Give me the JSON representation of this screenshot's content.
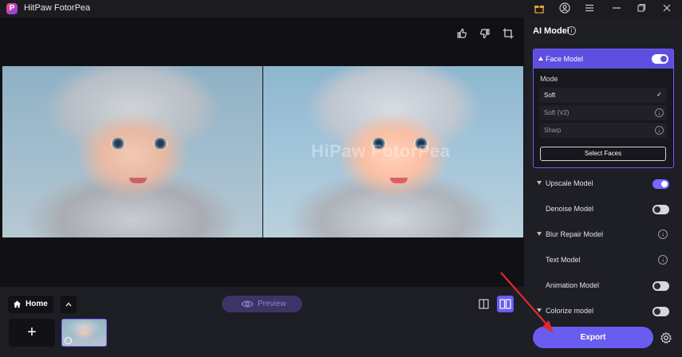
{
  "titlebar": {
    "logo_letter": "P",
    "title": "HitPaw FotorPea",
    "icons": [
      "gift-icon",
      "account-icon",
      "menu-icon",
      "minimize-icon",
      "restore-icon",
      "close-icon"
    ]
  },
  "canvas": {
    "watermark": "HiPaw FotorPea",
    "tools": [
      "thumbs-up-icon",
      "thumbs-down-icon",
      "crop-icon"
    ],
    "zoom": {
      "in_label": "+",
      "out_label": "−"
    }
  },
  "bottombar": {
    "home_label": "Home",
    "up_label": "^",
    "preview_label": "Preview",
    "add_label": "+"
  },
  "panel": {
    "title": "AI Model",
    "info": "i",
    "face_model": {
      "label": "Face Model",
      "enabled": true,
      "mode_label": "Mode",
      "modes": [
        {
          "label": "Soft",
          "state": "selected",
          "mark": "✓"
        },
        {
          "label": "Soft (V2)",
          "state": "download",
          "mark": "↓"
        },
        {
          "label": "Sharp",
          "state": "download",
          "mark": "↓"
        }
      ],
      "select_faces_label": "Select Faces"
    },
    "models": [
      {
        "label": "Upscale Model",
        "control": "toggle",
        "enabled": true,
        "expand": true
      },
      {
        "label": "Denoise Model",
        "control": "toggle",
        "enabled": false,
        "expand": false
      },
      {
        "label": "Blur Repair Model",
        "control": "download",
        "expand": true,
        "mark": "↓"
      },
      {
        "label": "Text Model",
        "control": "download",
        "expand": false,
        "mark": "↓"
      },
      {
        "label": "Animation Model",
        "control": "toggle",
        "enabled": false,
        "expand": false
      },
      {
        "label": "Colorize model",
        "control": "toggle",
        "enabled": false,
        "expand": true
      }
    ],
    "export_label": "Export"
  },
  "colors": {
    "accent": "#6b5cf0",
    "annotation_arrow": "#e0282e"
  }
}
